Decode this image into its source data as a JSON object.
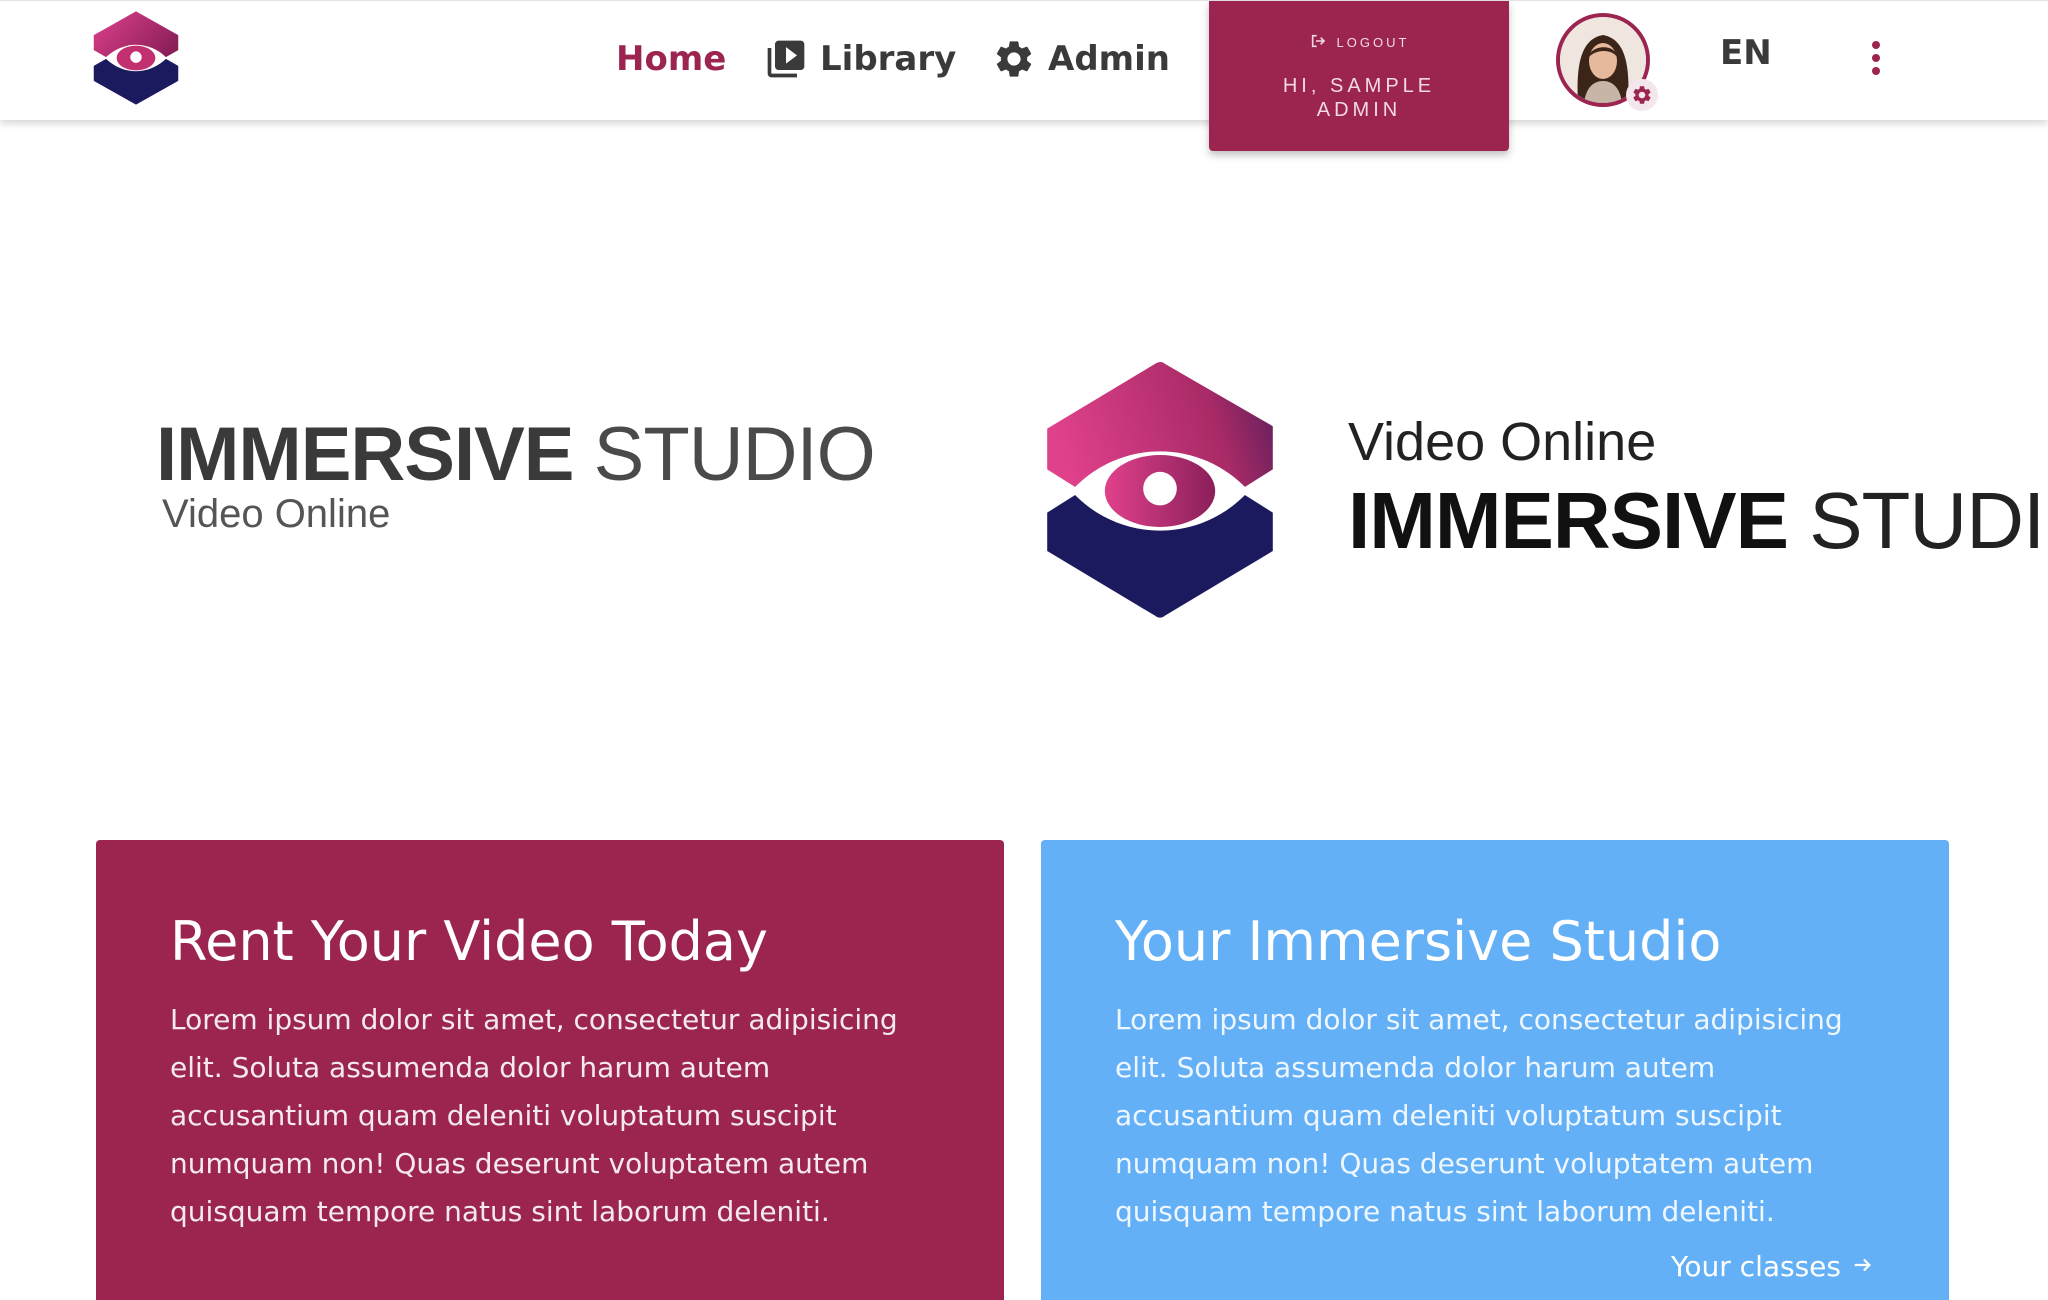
{
  "header": {
    "nav": {
      "home": "Home",
      "library": "Library",
      "admin": "Admin"
    },
    "user": {
      "logout": "LOGOUT",
      "greeting": "HI, SAMPLE ADMIN"
    },
    "language": "EN"
  },
  "hero": {
    "left": {
      "brand_strong": "IMMERSIVE",
      "brand_light": "STUDIO",
      "subtitle": "Video Online"
    },
    "right": {
      "subtitle": "Video Online",
      "brand_strong": "IMMERSIVE",
      "brand_light": "STUDIO"
    }
  },
  "cards": [
    {
      "title": "Rent Your Video Today",
      "text": "Lorem ipsum dolor sit amet, consectetur adipisicing elit. Soluta assumenda dolor harum autem accusantium quam deleniti voluptatum suscipit numquam non! Quas deserunt voluptatem autem quisquam tempore natus sint laborum deleniti."
    },
    {
      "title": "Your Immersive Studio",
      "text": "Lorem ipsum dolor sit amet, consectetur adipisicing elit. Soluta assumenda dolor harum autem accusantium quam deleniti voluptatum suscipit numquam non! Quas deserunt voluptatem autem quisquam tempore natus sint laborum deleniti.",
      "link": "Your classes"
    }
  ],
  "colors": {
    "brand": "#9b2550",
    "accent_blue": "#63b0f6",
    "logo_navy": "#1c1a5e",
    "logo_pink": "#e0418b"
  },
  "icons": {
    "library": "video-library-icon",
    "admin": "gear-icon",
    "logout": "logout-icon",
    "menu": "more-vertical-icon",
    "link": "arrow-right-icon"
  }
}
